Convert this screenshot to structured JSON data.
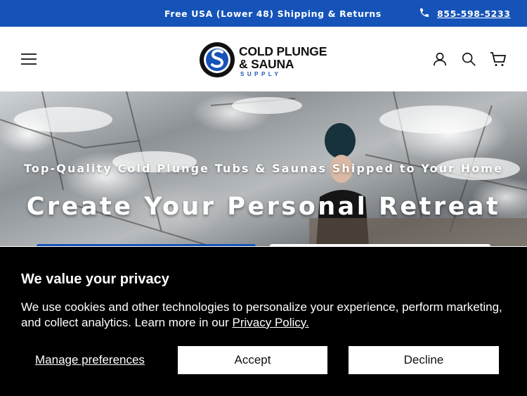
{
  "topbar": {
    "announcement": "Free USA (Lower 48) Shipping & Returns",
    "phone": "855-598-5233"
  },
  "header": {
    "logo_line1": "COLD PLUNGE",
    "logo_line2": "& SAUNA",
    "logo_line3": "SUPPLY",
    "brand_color": "#1553b8"
  },
  "hero": {
    "subtitle": "Top-Quality Cold Plunge Tubs & Saunas Shipped to Your Home",
    "title": "Create Your Personal Retreat"
  },
  "cookie": {
    "heading": "We value your privacy",
    "body": "We use cookies and other technologies to personalize your experience, perform marketing, and collect analytics. Learn more in our ",
    "policy_link": "Privacy Policy.",
    "manage_label": "Manage preferences",
    "accept_label": "Accept",
    "decline_label": "Decline"
  }
}
